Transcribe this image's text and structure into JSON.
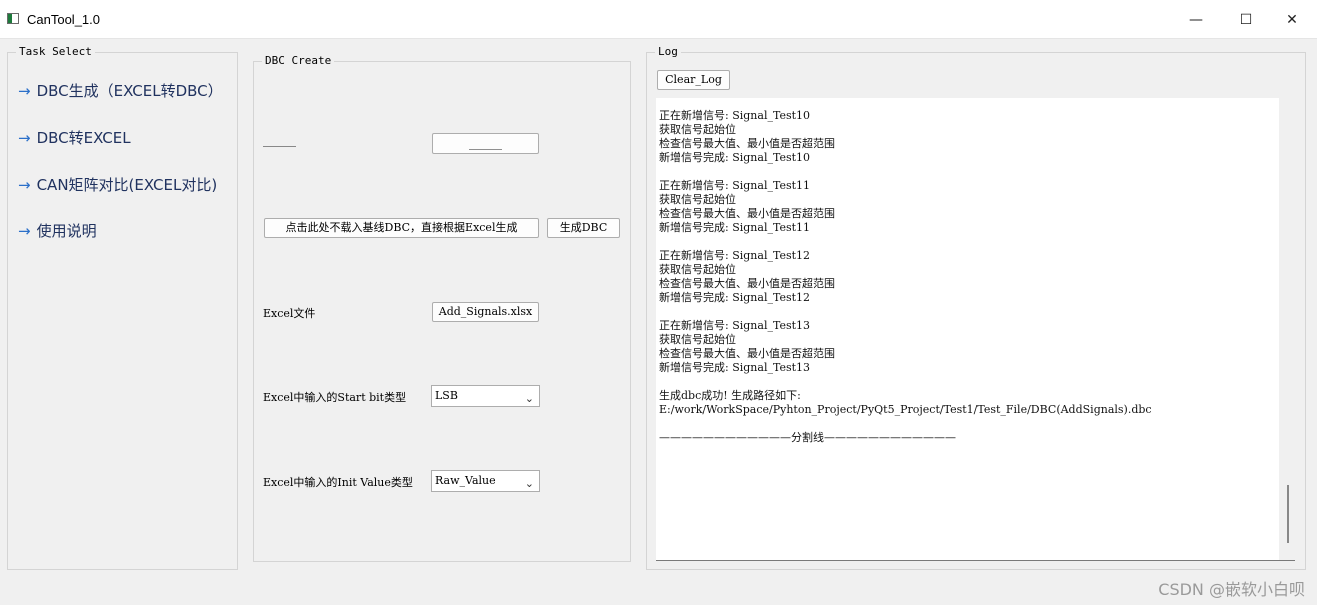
{
  "window": {
    "title": "CanTool_1.0",
    "minimize_glyph": "—",
    "maximize_glyph": "☐",
    "close_glyph": "✕"
  },
  "task_select": {
    "title": "Task Select",
    "arrow_glyph": "→",
    "items": [
      {
        "label": "DBC生成（EXCEL转DBC）"
      },
      {
        "label": "DBC转EXCEL"
      },
      {
        "label": "CAN矩阵对比(EXCEL对比)"
      },
      {
        "label": "使用说明"
      }
    ]
  },
  "dbc_create": {
    "title": "DBC Create",
    "baseline_label": "______",
    "baseline_button": "______",
    "no_baseline_button": "点击此处不载入基线DBC，直接根据Excel生成",
    "generate_button": "生成DBC",
    "excel_file_label": "Excel文件",
    "excel_file_button": "Add_Signals.xlsx",
    "start_bit_label": "Excel中输入的Start bit类型",
    "start_bit_value": "LSB",
    "init_value_label": "Excel中输入的Init Value类型",
    "init_value_value": "Raw_Value"
  },
  "log": {
    "title": "Log",
    "clear_button": "Clear_Log",
    "text": "正在新增信号: Signal_Test10\n获取信号起始位\n检查信号最大值、最小值是否超范围\n新增信号完成: Signal_Test10\n\n正在新增信号: Signal_Test11\n获取信号起始位\n检查信号最大值、最小值是否超范围\n新增信号完成: Signal_Test11\n\n正在新增信号: Signal_Test12\n获取信号起始位\n检查信号最大值、最小值是否超范围\n新增信号完成: Signal_Test12\n\n正在新增信号: Signal_Test13\n获取信号起始位\n检查信号最大值、最小值是否超范围\n新增信号完成: Signal_Test13\n\n生成dbc成功! 生成路径如下:\nE:/work/WorkSpace/Pyhton_Project/PyQt5_Project/Test1/Test_File/DBC(AddSignals).dbc\n\n————————————分割线————————————"
  },
  "watermark": "CSDN @嵌软小白呗"
}
